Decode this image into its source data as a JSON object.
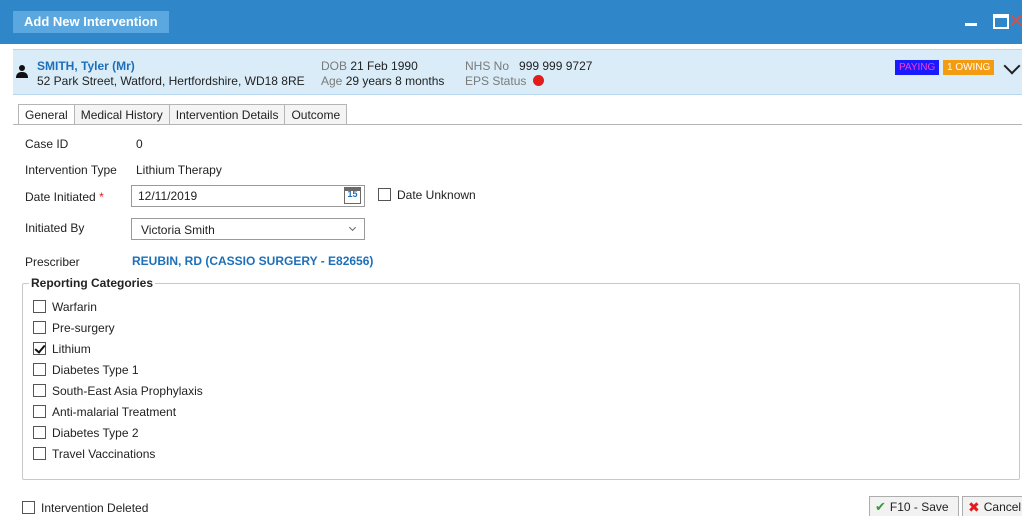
{
  "window": {
    "title": "Add New Intervention"
  },
  "patient": {
    "name": "SMITH, Tyler (Mr)",
    "address": "52 Park Street, Watford, Hertfordshire, WD18 8RE",
    "dob_label": "DOB",
    "dob": "21 Feb 1990",
    "age_label": "Age",
    "age": "29 years 8 months",
    "nhs_label": "NHS No",
    "nhs_no": "999 999 9727",
    "eps_label": "EPS Status",
    "eps_status_color": "#e31b1b",
    "badge_paying": "PAYING",
    "badge_owing": "1 OWING"
  },
  "tabs": [
    {
      "label": "General",
      "active": true
    },
    {
      "label": "Medical History",
      "active": false
    },
    {
      "label": "Intervention Details",
      "active": false
    },
    {
      "label": "Outcome",
      "active": false
    }
  ],
  "form": {
    "case_id_label": "Case ID",
    "case_id": "0",
    "intervention_type_label": "Intervention Type",
    "intervention_type": "Lithium Therapy",
    "date_initiated_label": "Date Initiated",
    "required_marker": "*",
    "date_initiated": "12/11/2019",
    "calendar_day": "15",
    "date_unknown_label": "Date Unknown",
    "initiated_by_label": "Initiated By",
    "initiated_by": "Victoria Smith",
    "prescriber_label": "Prescriber",
    "prescriber": "REUBIN, RD (CASSIO SURGERY - E82656)"
  },
  "reporting": {
    "title": "Reporting Categories",
    "items": [
      {
        "label": "Warfarin",
        "checked": false
      },
      {
        "label": "Pre-surgery",
        "checked": false
      },
      {
        "label": "Lithium",
        "checked": true
      },
      {
        "label": "Diabetes Type 1",
        "checked": false
      },
      {
        "label": "South-East Asia Prophylaxis",
        "checked": false
      },
      {
        "label": "Anti-malarial Treatment",
        "checked": false
      },
      {
        "label": "Diabetes Type 2",
        "checked": false
      },
      {
        "label": "Travel Vaccinations",
        "checked": false
      }
    ]
  },
  "footer": {
    "deleted_label": "Intervention Deleted",
    "save_label": "F10 - Save",
    "cancel_label": "Cancel"
  },
  "colors": {
    "titlebar": "#2f86c9",
    "banner": "#d9ecf8",
    "link_blue": "#1e6fba"
  }
}
